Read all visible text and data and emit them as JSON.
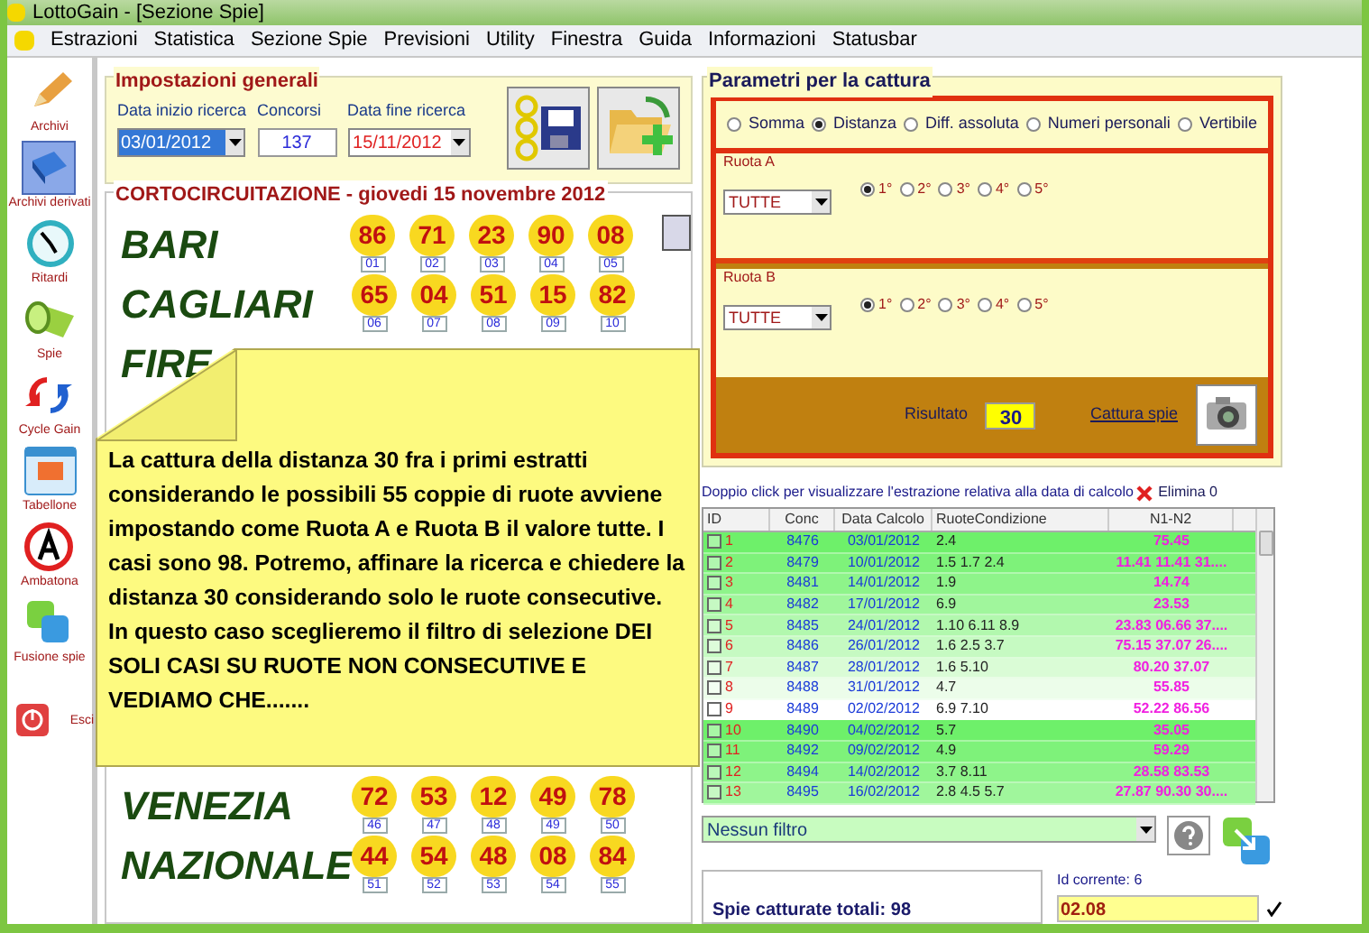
{
  "window": {
    "title": "LottoGain - [Sezione Spie]"
  },
  "menu": [
    "Estrazioni",
    "Statistica",
    "Sezione Spie",
    "Previsioni",
    "Utility",
    "Finestra",
    "Guida",
    "Informazioni",
    "Statusbar"
  ],
  "sidebar": [
    {
      "label": "Archivi",
      "selected": false
    },
    {
      "label": "Archivi derivati",
      "selected": true
    },
    {
      "label": "Ritardi",
      "selected": false
    },
    {
      "label": "Spie",
      "selected": false
    },
    {
      "label": "Cycle Gain",
      "selected": false
    },
    {
      "label": "Tabellone",
      "selected": false
    },
    {
      "label": "Ambatona",
      "selected": false
    },
    {
      "label": "Fusione spie",
      "selected": false
    },
    {
      "label": "Esci",
      "selected": false
    }
  ],
  "general_settings": {
    "title": "Impostazioni generali",
    "start_date": {
      "label": "Data inizio ricerca",
      "value": "03/01/2012"
    },
    "draws": {
      "label": "Concorsi",
      "value": "137"
    },
    "end_date": {
      "label": "Data fine ricerca",
      "value": "15/11/2012"
    }
  },
  "draw": {
    "title": "CORTOCIRCUITAZIONE - giovedi 15 novembre 2012",
    "upper_wheels": [
      {
        "name": "BARI",
        "balls": [
          {
            "number": "86",
            "index": "01"
          },
          {
            "number": "71",
            "index": "02"
          },
          {
            "number": "23",
            "index": "03"
          },
          {
            "number": "90",
            "index": "04"
          },
          {
            "number": "08",
            "index": "05"
          }
        ]
      },
      {
        "name": "CAGLIARI",
        "balls": [
          {
            "number": "65",
            "index": "06"
          },
          {
            "number": "04",
            "index": "07"
          },
          {
            "number": "51",
            "index": "08"
          },
          {
            "number": "15",
            "index": "09"
          },
          {
            "number": "82",
            "index": "10"
          }
        ]
      },
      {
        "name": "FIRE"
      }
    ],
    "lower_wheels": [
      {
        "name": "VENEZIA",
        "balls": [
          {
            "number": "72",
            "index": "46"
          },
          {
            "number": "53",
            "index": "47"
          },
          {
            "number": "12",
            "index": "48"
          },
          {
            "number": "49",
            "index": "49"
          },
          {
            "number": "78",
            "index": "50"
          }
        ]
      },
      {
        "name": "NAZIONALE",
        "balls": [
          {
            "number": "44",
            "index": "51"
          },
          {
            "number": "54",
            "index": "52"
          },
          {
            "number": "48",
            "index": "53"
          },
          {
            "number": "08",
            "index": "54"
          },
          {
            "number": "84",
            "index": "55"
          }
        ]
      }
    ]
  },
  "note": {
    "text": "La cattura della distanza 30 fra i primi estratti considerando le possibili 55 coppie di ruote avviene impostando come Ruota A  e Ruota B il valore tutte. I casi sono 98. Potremo, affinare la ricerca e chiedere la distanza 30 considerando solo le ruote consecutive. In questo caso sceglieremo il filtro di selezione DEI SOLI CASI SU RUOTE NON CONSECUTIVE E VEDIAMO CHE......."
  },
  "capture": {
    "title": "Parametri per la cattura",
    "modes": [
      {
        "label": "Somma",
        "selected": false
      },
      {
        "label": "Distanza",
        "selected": true
      },
      {
        "label": "Diff. assoluta",
        "selected": false
      },
      {
        "label": "Numeri personali",
        "selected": false
      },
      {
        "label": "Vertibile",
        "selected": false
      }
    ],
    "wheel_a": {
      "title": "Ruota A",
      "value": "TUTTE",
      "positions": [
        {
          "label": "1°",
          "selected": true
        },
        {
          "label": "2°",
          "selected": false
        },
        {
          "label": "3°",
          "selected": false
        },
        {
          "label": "4°",
          "selected": false
        },
        {
          "label": "5°",
          "selected": false
        }
      ]
    },
    "wheel_b": {
      "title": "Ruota B",
      "value": "TUTTE",
      "positions": [
        {
          "label": "1°",
          "selected": true
        },
        {
          "label": "2°",
          "selected": false
        },
        {
          "label": "3°",
          "selected": false
        },
        {
          "label": "4°",
          "selected": false
        },
        {
          "label": "5°",
          "selected": false
        }
      ]
    },
    "result": {
      "label": "Risultato",
      "value": "30"
    },
    "capture_link": "Cattura spie"
  },
  "results": {
    "hint": "Doppio click per visualizzare l'estrazione relativa alla data di calcolo",
    "delete": "Elimina 0",
    "columns": [
      "ID",
      "Conc",
      "Data Calcolo",
      "RuoteCondizione",
      "N1-N2"
    ],
    "rows": [
      {
        "id": "1",
        "checked": false,
        "conc": "8476",
        "date": "03/01/2012",
        "wheels": "2.4",
        "numbers": "75.45"
      },
      {
        "id": "2",
        "checked": false,
        "conc": "8479",
        "date": "10/01/2012",
        "wheels": "1.5 1.7 2.4",
        "numbers": "11.41 11.41 31...."
      },
      {
        "id": "3",
        "checked": false,
        "conc": "8481",
        "date": "14/01/2012",
        "wheels": "1.9",
        "numbers": "14.74"
      },
      {
        "id": "4",
        "checked": false,
        "conc": "8482",
        "date": "17/01/2012",
        "wheels": "6.9",
        "numbers": "23.53"
      },
      {
        "id": "5",
        "checked": false,
        "conc": "8485",
        "date": "24/01/2012",
        "wheels": "1.10 6.11 8.9",
        "numbers": "23.83 06.66 37...."
      },
      {
        "id": "6",
        "checked": false,
        "conc": "8486",
        "date": "26/01/2012",
        "wheels": "1.6 2.5 3.7",
        "numbers": "75.15 37.07 26...."
      },
      {
        "id": "7",
        "checked": false,
        "conc": "8487",
        "date": "28/01/2012",
        "wheels": "1.6 5.10",
        "numbers": "80.20 37.07"
      },
      {
        "id": "8",
        "checked": false,
        "conc": "8488",
        "date": "31/01/2012",
        "wheels": "4.7",
        "numbers": "55.85"
      },
      {
        "id": "9",
        "checked": false,
        "conc": "8489",
        "date": "02/02/2012",
        "wheels": "6.9 7.10",
        "numbers": "52.22 86.56"
      },
      {
        "id": "10",
        "checked": false,
        "conc": "8490",
        "date": "04/02/2012",
        "wheels": "5.7",
        "numbers": "35.05"
      },
      {
        "id": "11",
        "checked": false,
        "conc": "8492",
        "date": "09/02/2012",
        "wheels": "4.9",
        "numbers": "59.29"
      },
      {
        "id": "12",
        "checked": false,
        "conc": "8494",
        "date": "14/02/2012",
        "wheels": "3.7 8.11",
        "numbers": "28.58 83.53"
      },
      {
        "id": "13",
        "checked": false,
        "conc": "8495",
        "date": "16/02/2012",
        "wheels": "2.8 4.5 5.7",
        "numbers": "27.87 90.30 30...."
      }
    ],
    "filter": "Nessun filtro",
    "total": "Spie catturate totali: 98",
    "current": {
      "label": "Id corrente: 6",
      "value": "02.08"
    }
  }
}
